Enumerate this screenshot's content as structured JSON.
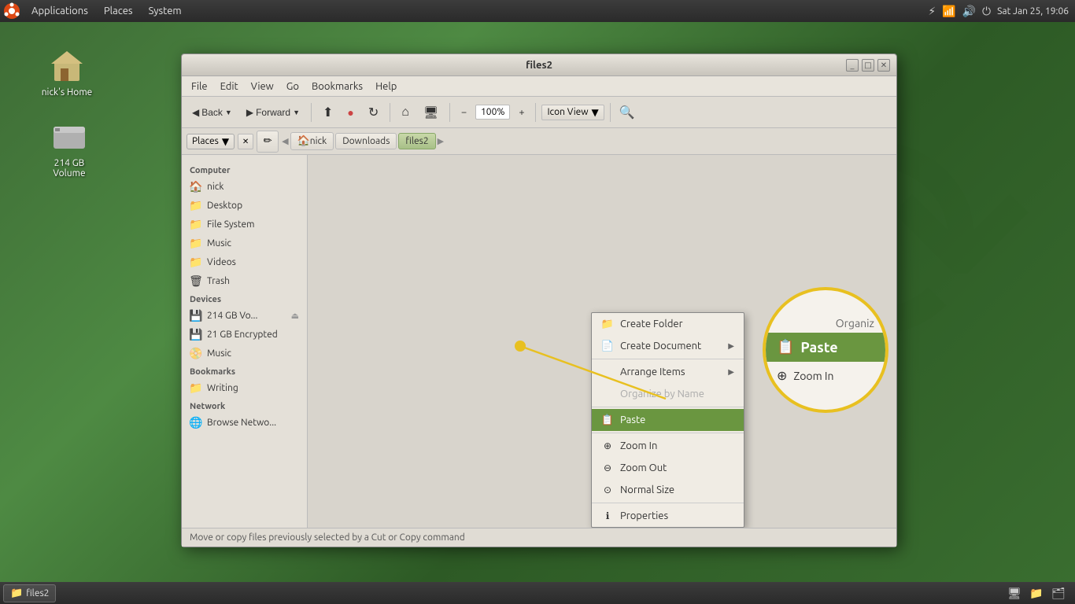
{
  "topPanel": {
    "menuItems": [
      "Applications",
      "Places",
      "System"
    ],
    "clock": "Sat Jan 25, 19:06"
  },
  "desktop": {
    "icons": [
      {
        "id": "nicks-home",
        "label": "nick's Home",
        "type": "home"
      },
      {
        "id": "volume-214",
        "label": "214 GB Volume",
        "type": "drive"
      }
    ]
  },
  "window": {
    "title": "files2",
    "menubar": [
      "File",
      "Edit",
      "View",
      "Go",
      "Bookmarks",
      "Help"
    ],
    "toolbar": {
      "back": "Back",
      "forward": "Forward",
      "up": "↑",
      "stopBtn": "●",
      "refresh": "↻",
      "home": "⌂",
      "computer": "🖥",
      "zoom_percent": "100%",
      "view_mode": "Icon View",
      "search_icon": "🔍"
    },
    "pathbar": {
      "places_label": "Places",
      "breadcrumbs": [
        "nick",
        "Downloads",
        "files2"
      ]
    },
    "sidebar": {
      "sections": [
        {
          "title": "Computer",
          "items": [
            {
              "label": "nick",
              "icon": "🏠"
            },
            {
              "label": "Desktop",
              "icon": "📁"
            },
            {
              "label": "File System",
              "icon": "📁"
            },
            {
              "label": "Music",
              "icon": "📁"
            },
            {
              "label": "Videos",
              "icon": "📁"
            },
            {
              "label": "Trash",
              "icon": "🗑"
            }
          ]
        },
        {
          "title": "Devices",
          "items": [
            {
              "label": "214 GB Vo...",
              "icon": "💾"
            },
            {
              "label": "21 GB Encrypted",
              "icon": "💾"
            },
            {
              "label": "Music",
              "icon": "📀"
            }
          ]
        },
        {
          "title": "Bookmarks",
          "items": [
            {
              "label": "Writing",
              "icon": "📁"
            }
          ]
        },
        {
          "title": "Network",
          "items": [
            {
              "label": "Browse Netwo...",
              "icon": "🌐"
            }
          ]
        }
      ]
    },
    "statusbar": "Move or copy files previously selected by a Cut or Copy command"
  },
  "contextMenu": {
    "items": [
      {
        "id": "create-folder",
        "label": "Create Folder",
        "icon": "📁",
        "hasArrow": false,
        "disabled": false,
        "highlighted": false
      },
      {
        "id": "create-document",
        "label": "Create Document",
        "icon": "📄",
        "hasArrow": true,
        "disabled": false,
        "highlighted": false
      },
      {
        "id": "arrange-items",
        "label": "Arrange Items",
        "icon": "",
        "hasArrow": true,
        "disabled": false,
        "highlighted": false
      },
      {
        "id": "organize-by-name",
        "label": "Organize by Name",
        "icon": "",
        "hasArrow": false,
        "disabled": true,
        "highlighted": false
      },
      {
        "id": "paste",
        "label": "Paste",
        "icon": "📋",
        "hasArrow": false,
        "disabled": false,
        "highlighted": true
      },
      {
        "id": "zoom-in",
        "label": "Zoom In",
        "icon": "🔍",
        "hasArrow": false,
        "disabled": false,
        "highlighted": false
      },
      {
        "id": "zoom-out",
        "label": "Zoom Out",
        "icon": "🔍",
        "hasArrow": false,
        "disabled": false,
        "highlighted": false
      },
      {
        "id": "normal-size",
        "label": "Normal Size",
        "icon": "🔍",
        "hasArrow": false,
        "disabled": false,
        "highlighted": false
      },
      {
        "id": "properties",
        "label": "Properties",
        "icon": "ℹ",
        "hasArrow": false,
        "disabled": false,
        "highlighted": false
      }
    ]
  },
  "zoomCallout": {
    "title": "Organiz",
    "pasteLabel": "Paste",
    "zoomInLabel": "Zoom In"
  },
  "taskbar": {
    "item": "files2"
  }
}
